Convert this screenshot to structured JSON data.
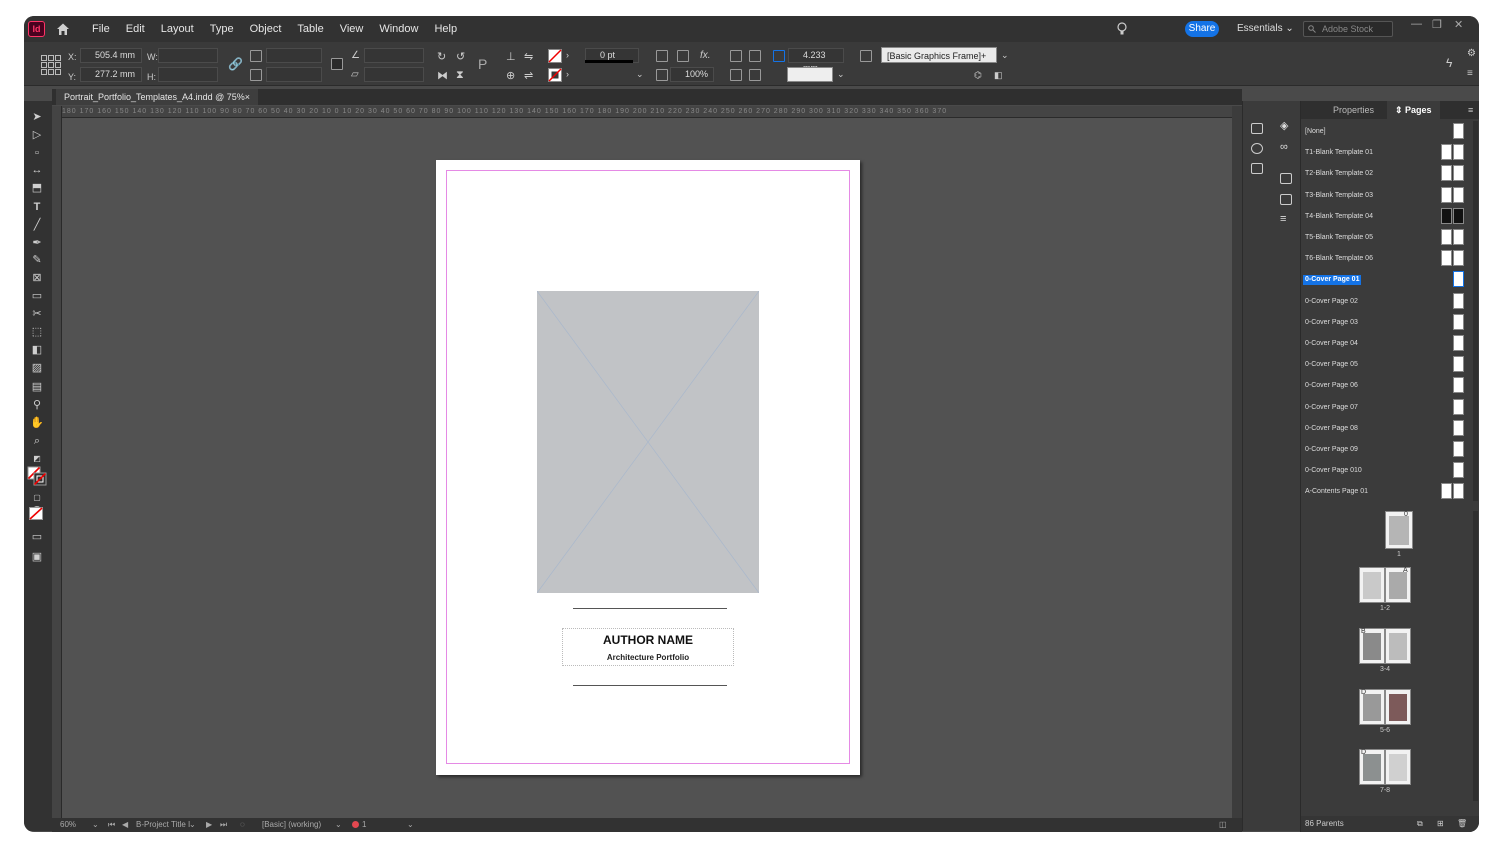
{
  "app": {
    "icon_label": "Id"
  },
  "menu": [
    "File",
    "Edit",
    "Layout",
    "Type",
    "Object",
    "Table",
    "View",
    "Window",
    "Help"
  ],
  "topbar": {
    "share": "Share",
    "workspace": "Essentials",
    "search_placeholder": "Adobe Stock"
  },
  "control": {
    "x_label": "X:",
    "x_value": "505.4 mm",
    "y_label": "Y:",
    "y_value": "277.2 mm",
    "w_label": "W:",
    "h_label": "H:",
    "stroke_weight": "0 pt",
    "opacity": "100%",
    "gap": "4.233 mm",
    "object_style": "[Basic Graphics Frame]+"
  },
  "document": {
    "tab_title": "Portrait_Portfolio_Templates_A4.indd @ 75%",
    "close": "×",
    "author_name": "AUTHOR NAME",
    "subtitle": "Architecture Portfolio"
  },
  "ruler_ticks": [
    "180",
    "170",
    "160",
    "150",
    "140",
    "130",
    "120",
    "110",
    "100",
    "90",
    "80",
    "70",
    "60",
    "50",
    "40",
    "30",
    "20",
    "10",
    "0",
    "10",
    "20",
    "30",
    "40",
    "50",
    "60",
    "70",
    "80",
    "90",
    "100",
    "110",
    "120",
    "130",
    "140",
    "150",
    "160",
    "170",
    "180",
    "190",
    "200",
    "210",
    "220",
    "230",
    "240",
    "250",
    "260",
    "270",
    "280",
    "290",
    "300",
    "310",
    "320",
    "330",
    "340",
    "350",
    "360",
    "370"
  ],
  "status": {
    "zoom": "60%",
    "page": "B-Project Title I",
    "preflight_profile": "[Basic] (working)",
    "errors": "1 error"
  },
  "panel": {
    "tabs": [
      "Properties",
      "Pages"
    ],
    "active_tab": "Pages",
    "parents": [
      {
        "label": "[None]"
      },
      {
        "label": "T1-Blank Template 01"
      },
      {
        "label": "T2-Blank Template 02"
      },
      {
        "label": "T3-Blank Template 03"
      },
      {
        "label": "T4-Blank Template 04"
      },
      {
        "label": "T5-Blank Template 05"
      },
      {
        "label": "T6-Blank Template 06"
      },
      {
        "label": "0-Cover Page 01"
      },
      {
        "label": "0-Cover Page 02"
      },
      {
        "label": "0-Cover Page 03"
      },
      {
        "label": "0-Cover Page 04"
      },
      {
        "label": "0-Cover Page 05"
      },
      {
        "label": "0-Cover Page 06"
      },
      {
        "label": "0-Cover Page 07"
      },
      {
        "label": "0-Cover Page 08"
      },
      {
        "label": "0-Cover Page 09"
      },
      {
        "label": "0-Cover Page 010"
      },
      {
        "label": "A-Contents Page 01"
      }
    ],
    "selected_parent": "0-Cover Page 01",
    "pages": [
      {
        "label": "1",
        "prefix": "0"
      },
      {
        "label": "1-2",
        "prefix": "A"
      },
      {
        "label": "3-4",
        "prefix": "B"
      },
      {
        "label": "5-6",
        "prefix": "D"
      },
      {
        "label": "7-8",
        "prefix": "D"
      }
    ],
    "footer": "86 Parents"
  },
  "colors": {
    "accent": "#1473e6",
    "margin_guide": "#e58ae5",
    "image_placeholder": "#c1c3c6"
  }
}
